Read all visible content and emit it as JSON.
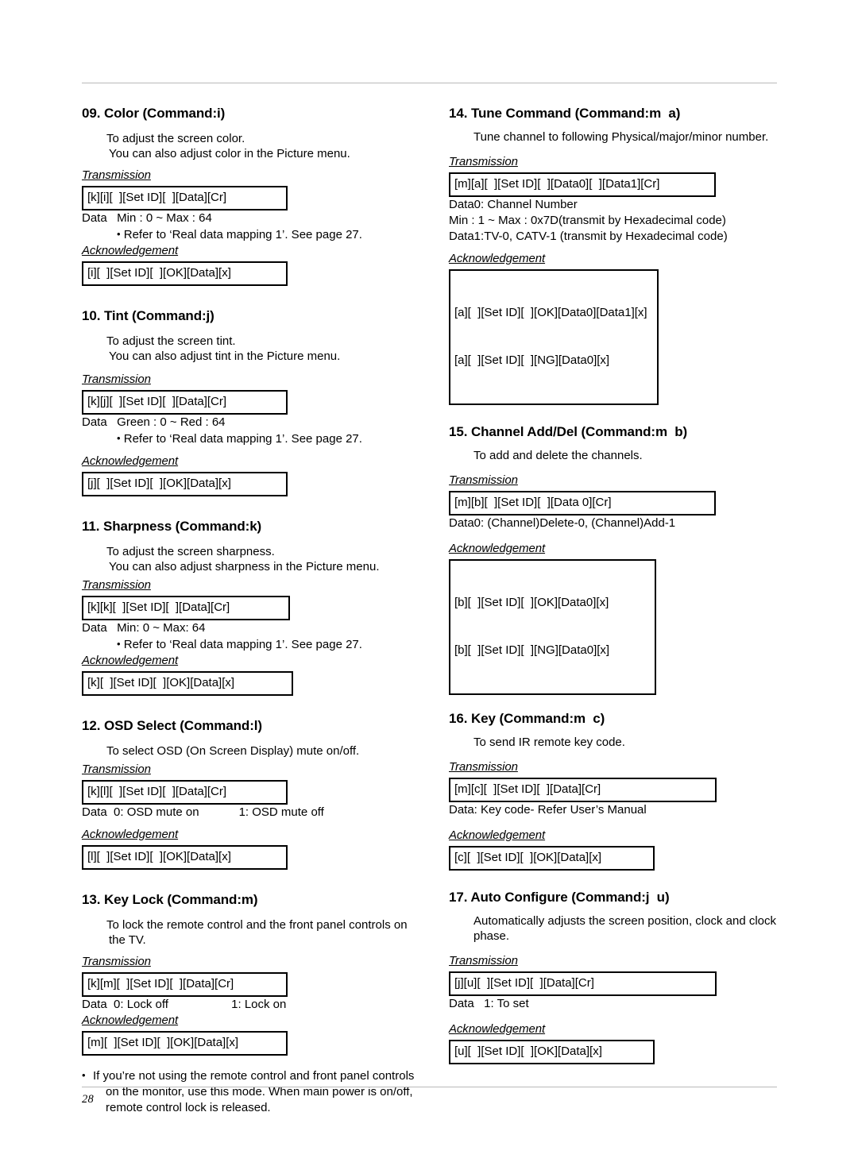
{
  "page": {
    "number": "28"
  },
  "labels": {
    "transmission": "Transmission",
    "acknowledgement": "Acknowledgement",
    "bullet": "•"
  },
  "left_column": [
    {
      "title": "09. Color (Command:i)",
      "desc_line1": "To adjust the screen color.",
      "desc_line2": "You can also adjust color in the Picture menu.",
      "transmission_code": "[k][i][  ][Set ID][  ][Data][Cr]",
      "data_line": "Data   Min : 0 ~ Max : 64",
      "refer_note": "Refer to ‘Real data mapping 1’. See page 27.",
      "ack_code": "[i][  ][Set ID][  ][OK][Data][x]"
    },
    {
      "title": "10. Tint (Command:j)",
      "desc_line1": "To adjust the screen tint.",
      "desc_line2": "You can also adjust tint in the Picture menu.",
      "transmission_code": "[k][j][  ][Set ID][  ][Data][Cr]",
      "data_line": "Data   Green : 0 ~ Red : 64",
      "refer_note": "Refer to ‘Real data mapping 1’. See page 27.",
      "ack_code": "[j][  ][Set ID][  ][OK][Data][x]"
    },
    {
      "title": "11. Sharpness (Command:k)",
      "desc_line1": "To adjust the screen sharpness.",
      "desc_line2": "You can also adjust sharpness in the Picture menu.",
      "transmission_code": "[k][k][  ][Set ID][  ][Data][Cr]",
      "data_line": "Data   Min: 0 ~ Max: 64",
      "refer_note": "Refer to ‘Real data mapping 1’. See page 27.",
      "ack_code": "[k][  ][Set ID][  ][OK][Data][x]"
    },
    {
      "title": "12. OSD Select (Command:l)",
      "desc_line1": "To select OSD (On Screen Display) mute on/off.",
      "transmission_code": "[k][l][  ][Set ID][  ][Data][Cr]",
      "data_line": "Data  0: OSD mute on            1: OSD mute off",
      "ack_code": "[l][  ][Set ID][  ][OK][Data][x]"
    },
    {
      "title": "13. Key Lock (Command:m)",
      "desc_line1": "To lock the remote control and the front panel controls on",
      "desc_line2": "the TV.",
      "transmission_code": "[k][m][  ][Set ID][  ][Data][Cr]",
      "data_line": "Data  0: Lock off                   1: Lock on",
      "ack_code": "[m][  ][Set ID][  ][OK][Data][x]",
      "footnote_line1": "If you’re not using the remote control and front panel controls",
      "footnote_line2": "on the monitor, use this mode. When main power is on/off,",
      "footnote_line3": "remote control lock is released."
    }
  ],
  "right_column": [
    {
      "title": "14. Tune Command (Command:m  a)",
      "desc_line1": "Tune channel to following Physical/major/minor number.",
      "transmission_code": "[m][a][  ][Set ID][  ][Data0][  ][Data1][Cr]",
      "data_line1": "Data0: Channel Number",
      "data_line2": "Min : 1 ~ Max : 0x7D(transmit by Hexadecimal code)",
      "data_line3": "Data1:TV-0, CATV-1 (transmit by Hexadecimal code)",
      "ack_code_line1": "[a][  ][Set ID][  ][OK][Data0][Data1][x]",
      "ack_code_line2": "[a][  ][Set ID][  ][NG][Data0][x]"
    },
    {
      "title": "15. Channel Add/Del (Command:m  b)",
      "desc_line1": "To add and delete the channels.",
      "transmission_code": "[m][b][  ][Set ID][  ][Data 0][Cr]",
      "data_line1": "Data0: (Channel)Delete-0, (Channel)Add-1",
      "ack_code_line1": "[b][  ][Set ID][  ][OK][Data0][x]",
      "ack_code_line2": "[b][  ][Set ID][  ][NG][Data0][x]"
    },
    {
      "title": "16. Key (Command:m  c)",
      "desc_line1": "To send IR remote key code.",
      "transmission_code": "[m][c][  ][Set ID][  ][Data][Cr]",
      "data_line1": "Data: Key code- Refer User’s Manual",
      "ack_code_line1": "[c][  ][Set ID][  ][OK][Data][x]"
    },
    {
      "title": "17. Auto Configure (Command:j  u)",
      "desc_line1": "Automatically adjusts the screen position, clock and clock",
      "desc_line2": "phase.",
      "transmission_code": "[j][u][  ][Set ID][  ][Data][Cr]",
      "data_line1": "Data   1: To set",
      "ack_code_line1": "[u][  ][Set ID][  ][OK][Data][x]"
    }
  ]
}
